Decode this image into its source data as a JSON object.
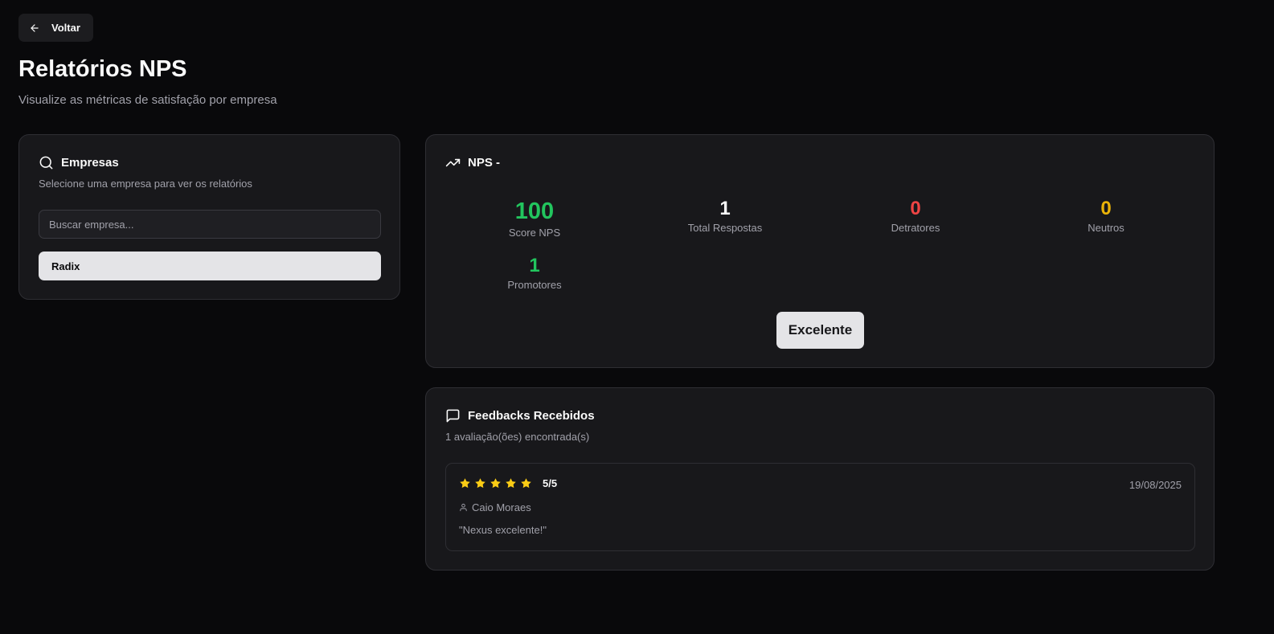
{
  "header": {
    "back_label": "Voltar",
    "title": "Relatórios NPS",
    "subtitle": "Visualize as métricas de satisfação por empresa"
  },
  "companies": {
    "title": "Empresas",
    "description": "Selecione uma empresa para ver os relatórios",
    "search_placeholder": "Buscar empresa...",
    "items": [
      {
        "label": "Radix"
      }
    ]
  },
  "nps": {
    "title": "NPS -",
    "metrics": [
      {
        "value": "100",
        "label": "Score NPS",
        "color": "#22c55e"
      },
      {
        "value": "1",
        "label": "Total Respostas",
        "color": "#fafafa"
      },
      {
        "value": "0",
        "label": "Detratores",
        "color": "#ef4444"
      },
      {
        "value": "0",
        "label": "Neutros",
        "color": "#eab308"
      },
      {
        "value": "1",
        "label": "Promotores",
        "color": "#22c55e"
      }
    ],
    "rating": "Excelente"
  },
  "feedback": {
    "title": "Feedbacks Recebidos",
    "count_text": "1 avaliação(ões) encontrada(s)",
    "items": [
      {
        "stars": 5,
        "score": "5/5",
        "date": "19/08/2025",
        "author": "Caio Moraes",
        "text": "\"Nexus excelente!\""
      }
    ]
  },
  "colors": {
    "background": "#09090b",
    "card": "#18181b",
    "star": "#facc15",
    "promoter": "#22c55e",
    "detractor": "#ef4444",
    "neutral": "#eab308"
  }
}
